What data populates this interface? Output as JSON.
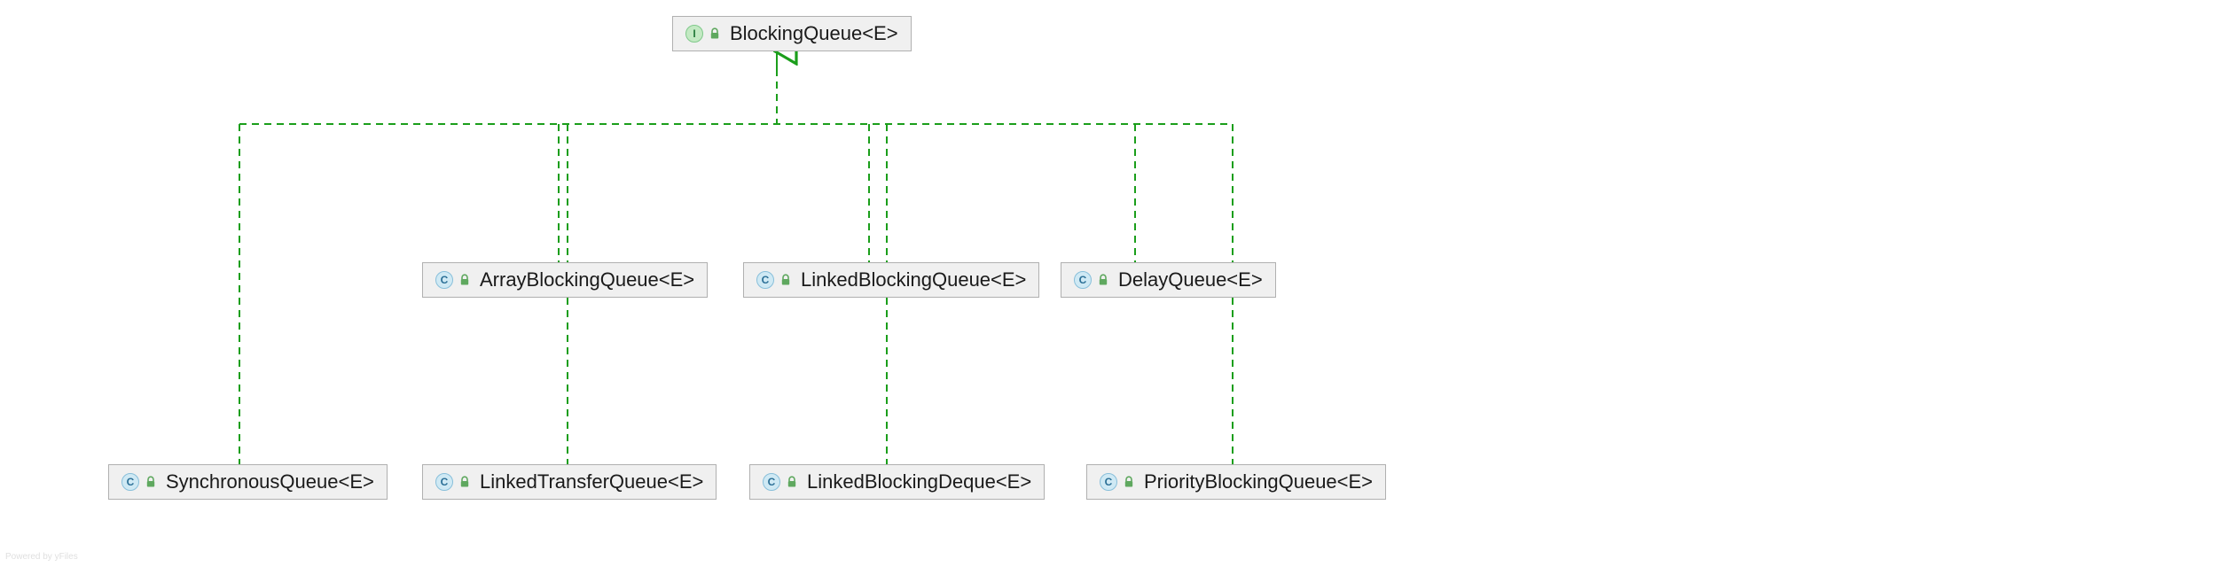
{
  "diagram": {
    "root": {
      "name": "BlockingQueue<E>",
      "kind": "interface"
    },
    "middle_row": [
      {
        "name": "ArrayBlockingQueue<E>",
        "kind": "class"
      },
      {
        "name": "LinkedBlockingQueue<E>",
        "kind": "class"
      },
      {
        "name": "DelayQueue<E>",
        "kind": "class"
      }
    ],
    "bottom_row": [
      {
        "name": "SynchronousQueue<E>",
        "kind": "class"
      },
      {
        "name": "LinkedTransferQueue<E>",
        "kind": "class"
      },
      {
        "name": "LinkedBlockingDeque<E>",
        "kind": "class"
      },
      {
        "name": "PriorityBlockingQueue<E>",
        "kind": "class"
      }
    ]
  },
  "icons": {
    "interface_letter": "I",
    "class_letter": "C"
  },
  "colors": {
    "connector": "#1b9e1b",
    "node_bg": "#f0f0f0",
    "node_border": "#b0b0b0",
    "lock_fill": "#5fa85f"
  },
  "watermark": "Powered by yFiles"
}
